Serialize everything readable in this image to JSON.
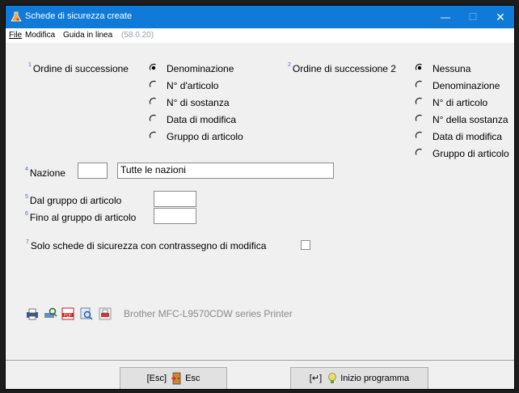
{
  "window": {
    "title": "Schede di sicurezza create"
  },
  "menu": {
    "file": "File",
    "edit": "Modifica",
    "help": "Guida in linea",
    "version": "(58.0.20)"
  },
  "sort1": {
    "num": "1",
    "label": "Ordine di successione",
    "options": [
      "Denominazione",
      "N° d'articolo",
      "N° di sostanza",
      "Data di modifica",
      "Gruppo di articolo"
    ],
    "selected": 0
  },
  "sort2": {
    "num": "2",
    "label": "Ordine di successione 2",
    "options": [
      "Nessuna",
      "Denominazione",
      "N° di articolo",
      "N° della sostanza",
      "Data di modifica",
      "Gruppo di articolo"
    ],
    "selected": 0
  },
  "nation": {
    "num": "4",
    "label": "Nazione",
    "code": "",
    "name": "Tutte le nazioni"
  },
  "group_from": {
    "num": "5",
    "label": "Dal gruppo di articolo",
    "value": ""
  },
  "group_to": {
    "num": "6",
    "label": "Fino al gruppo di articolo",
    "value": ""
  },
  "only_modified": {
    "num": "7",
    "label": "Solo schede di sicurezza con contrassegno di modifica",
    "checked": false
  },
  "printer": {
    "name": "Brother MFC-L9570CDW series Printer"
  },
  "buttons": {
    "esc_prefix": "[Esc]",
    "esc_label": "Esc",
    "start_prefix": "[↵]",
    "start_label": "Inizio programma"
  }
}
